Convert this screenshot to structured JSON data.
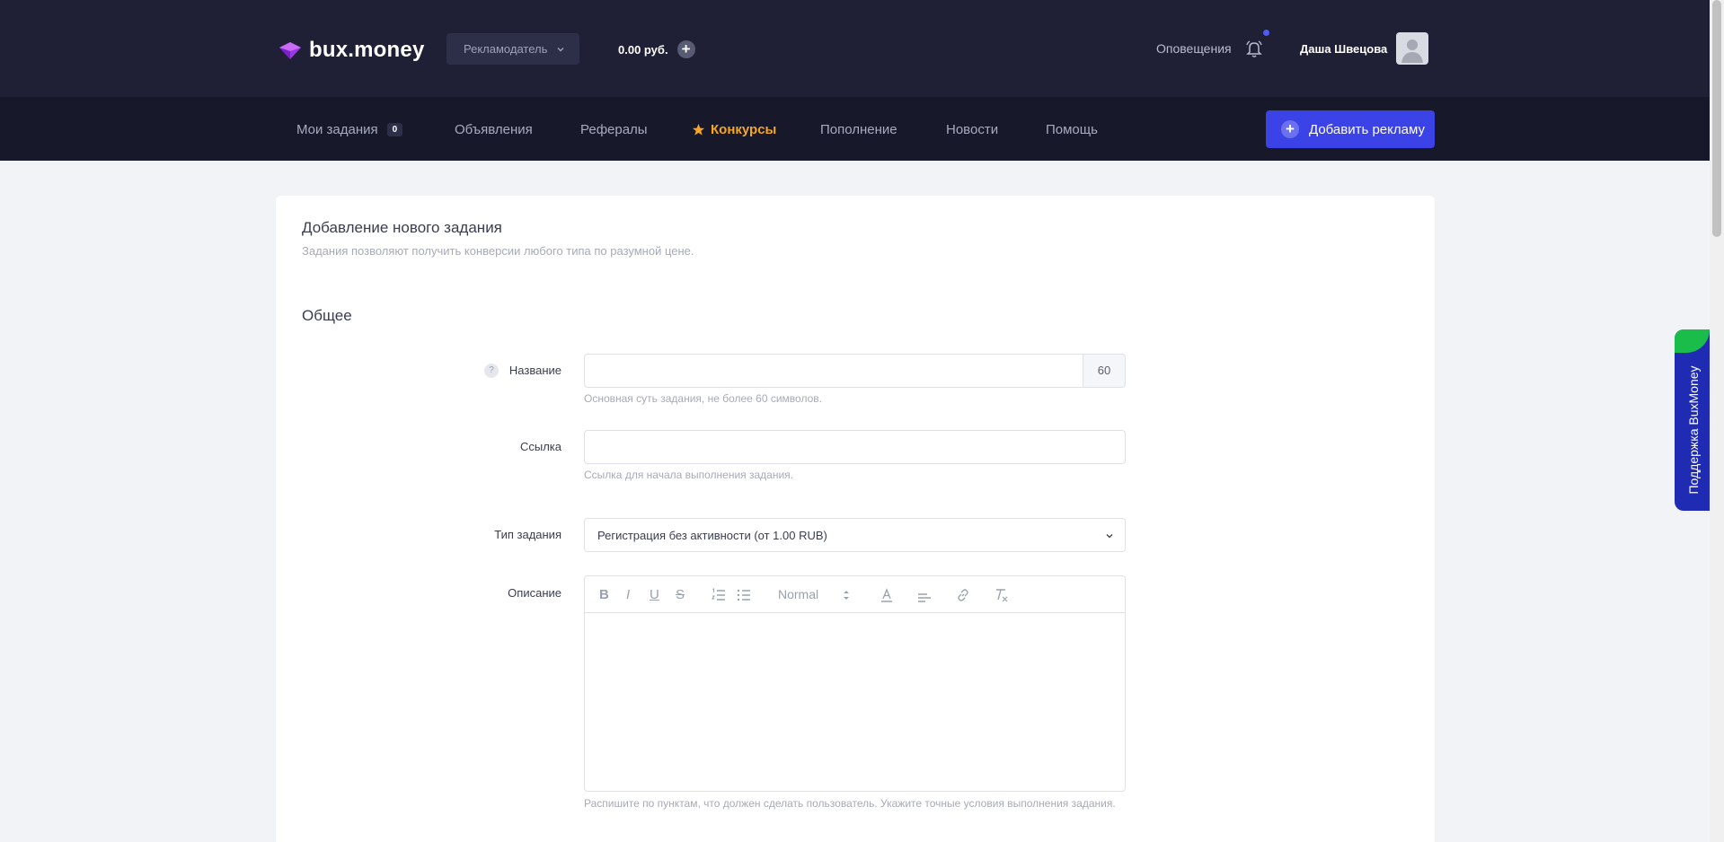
{
  "header": {
    "logo_text": "bux.money",
    "role_select": "Рекламодатель",
    "balance": "0.00 руб.",
    "notifications_label": "Оповещения",
    "user_name": "Даша Швецова"
  },
  "nav": {
    "items": [
      {
        "label": "Мои задания",
        "badge": "0"
      },
      {
        "label": "Объявления"
      },
      {
        "label": "Рефералы"
      },
      {
        "label": "Конкурсы"
      },
      {
        "label": "Пополнение"
      },
      {
        "label": "Новости"
      },
      {
        "label": "Помощь"
      }
    ],
    "add_ad_label": "Добавить рекламу"
  },
  "form": {
    "title": "Добавление нового задания",
    "subtitle": "Задания позволяют получить конверсии любого типа по разумной цене.",
    "section": "Общее",
    "name": {
      "label": "Название",
      "value": "",
      "counter": "60",
      "hint": "Основная суть задания, не более 60 символов."
    },
    "link": {
      "label": "Ссылка",
      "value": "",
      "hint": "Ссылка для начала выполнения задания."
    },
    "task_type": {
      "label": "Тип задания",
      "value": "Регистрация без активности (от 1.00 RUB)"
    },
    "description": {
      "label": "Описание",
      "toolbar": {
        "bold": "B",
        "italic": "I",
        "underline": "U",
        "strike": "S",
        "format": "Normal"
      },
      "hint": "Распишите по пунктам, что должен сделать пользователь. Укажите точные условия выполнения задания."
    }
  },
  "support_tab": "Поддержка BuxMoney",
  "colors": {
    "header_bg": "#1f2035",
    "nav_bg": "#17182a",
    "accent": "#3b42e6",
    "active_nav": "#f5a623",
    "support_bg": "#1f2bb3",
    "logo": "#b13cf0"
  },
  "icons": [
    "logo-icon",
    "chevron-down-icon",
    "plus-icon",
    "bell-icon",
    "avatar-icon",
    "star-icon",
    "help-icon",
    "bold-icon",
    "italic-icon",
    "underline-icon",
    "strike-icon",
    "ordered-list-icon",
    "bullet-list-icon",
    "text-color-icon",
    "align-icon",
    "link-icon",
    "clear-format-icon"
  ]
}
